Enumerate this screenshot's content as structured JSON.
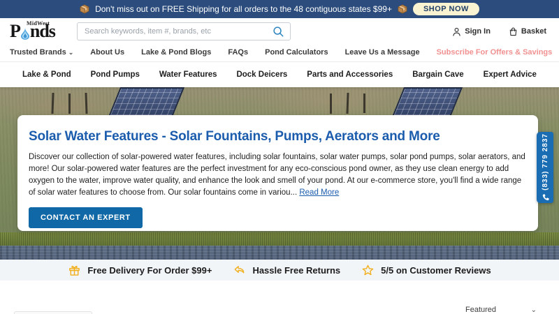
{
  "announcement": {
    "text": "Don't miss out on FREE Shipping for all orders to the 48 contiguous states $99+",
    "shop_now_label": "SHOP NOW"
  },
  "header": {
    "logo": {
      "prefix": "P",
      "suffix": "nds",
      "region": "MidWest"
    },
    "search_placeholder": "Search keywords, item #, brands, etc",
    "sign_in_label": "Sign In",
    "basket_label": "Basket"
  },
  "secondary_nav": {
    "items": [
      "Trusted Brands",
      "About Us",
      "Lake & Pond Blogs",
      "FAQs",
      "Pond Calculators",
      "Leave Us a Message",
      "Subscribe For Offers & Savings"
    ]
  },
  "main_nav": {
    "items": [
      "Lake & Pond",
      "Pond Pumps",
      "Water Features",
      "Dock Deicers",
      "Parts and Accessories",
      "Bargain Cave",
      "Expert Advice"
    ]
  },
  "hero": {
    "title": "Solar Water Features - Solar Fountains, Pumps, Aerators and More",
    "description": "Discover our collection of solar-powered water features, including solar fountains, solar water pumps, solar pond pumps, solar aerators, and more! Our solar-powered water features are the perfect investment for any eco-conscious pond owner, as they use clean energy to add oxygen to the water, improve water quality, and enhance the look and smell of your pond. At our e-commerce store, you'll find a wide range of solar water features to choose from. Our solar fountains come in variou...",
    "read_more_label": "Read More",
    "contact_button_label": "CONTACT AN EXPERT",
    "phone_number": "(833) 779 2837"
  },
  "features": {
    "items": [
      {
        "icon": "gift-box-icon",
        "label": "Free Delivery For Order $99+"
      },
      {
        "icon": "return-arrow-icon",
        "label": "Hassle Free Returns"
      },
      {
        "icon": "star-icon",
        "label": "5/5 on Customer Reviews"
      }
    ]
  },
  "product_toolbar": {
    "sort_selected": "Featured"
  },
  "colors": {
    "banner_bg": "#2b4c7c",
    "shop_now_bg": "#faf3d2",
    "accent_blue": "#1b5cad",
    "button_blue": "#1168a7",
    "phone_tab_blue": "#1a6db3",
    "subscribe_salmon": "#f19090",
    "feature_icon_yellow": "#f2b01e",
    "features_bg": "#f2f5f8"
  }
}
